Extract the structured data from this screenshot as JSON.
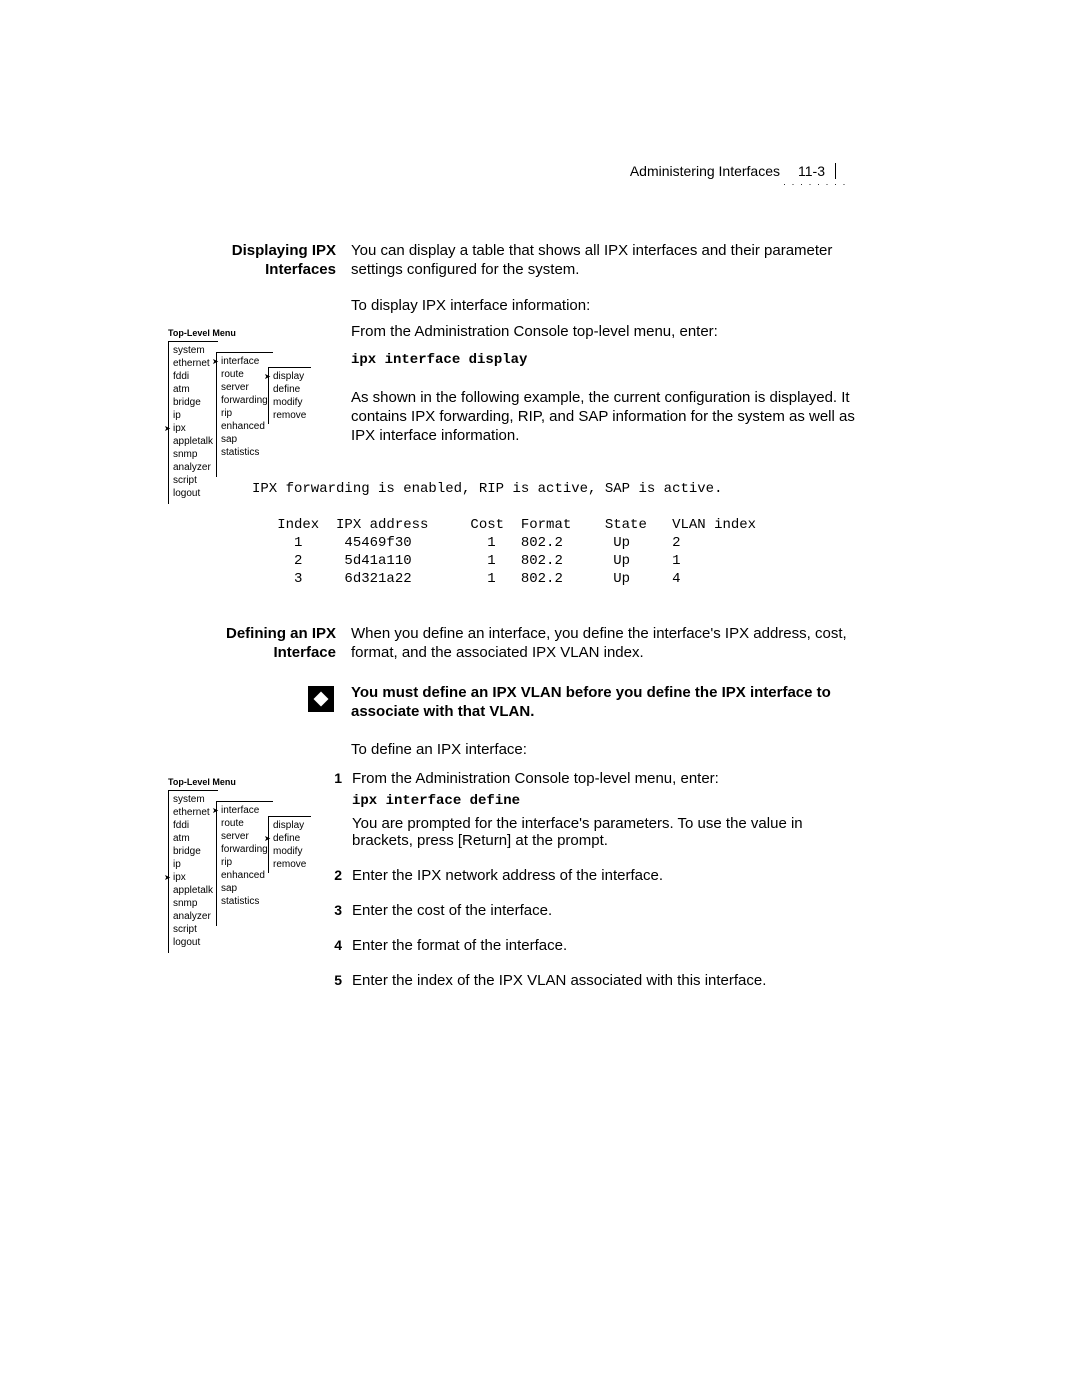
{
  "header": {
    "title": "Administering Interfaces",
    "pagenum": "11-3"
  },
  "s1": {
    "heading_l1": "Displaying IPX",
    "heading_l2": "Interfaces",
    "p1": "You can display a table that shows all IPX interfaces and their parameter settings configured for the system.",
    "p2": "To display IPX interface information:",
    "p3": "From the Administration Console top-level menu, enter:",
    "cmd": "ipx interface display",
    "p4": "As shown in the following example, the current configuration is displayed. It contains IPX forwarding, RIP, and SAP information for the system as well as IPX interface information.",
    "example": "IPX forwarding is enabled, RIP is active, SAP is active.\n\n   Index  IPX address     Cost  Format    State   VLAN index\n     1     45469f30         1   802.2      Up     2\n     2     5d41a110         1   802.2      Up     1\n     3     6d321a22         1   802.2      Up     4"
  },
  "s2": {
    "heading_l1": "Defining an IPX",
    "heading_l2": "Interface",
    "p1": "When you define an interface, you define the interface's IPX address, cost, format, and the associated IPX VLAN index.",
    "note": "You must define an IPX VLAN before you define the IPX interface to associate with that VLAN.",
    "p2": "To define an IPX interface:",
    "steps": {
      "1a": "From the Administration Console top-level menu, enter:",
      "cmd": "ipx interface define",
      "1b": "You are prompted for the interface's parameters. To use the value in brackets, press [Return] at the prompt.",
      "2": "Enter the IPX network address of the interface.",
      "3": "Enter the cost of the interface.",
      "4": "Enter the format of the interface.",
      "5": "Enter the index of the IPX VLAN associated with this interface."
    }
  },
  "menu": {
    "label": "Top-Level Menu",
    "col1": [
      "system",
      "ethernet",
      "fddi",
      "atm",
      "bridge",
      "ip",
      "ipx",
      "appletalk",
      "snmp",
      "analyzer",
      "script",
      "logout"
    ],
    "col2": [
      "interface",
      "route",
      "server",
      "forwarding",
      "rip",
      "enhanced",
      "sap",
      "statistics"
    ],
    "menu1_col3": [
      "display",
      "define",
      "modify",
      "remove"
    ],
    "menu2_col3": [
      "display",
      "define",
      "modify",
      "remove"
    ]
  },
  "chart_data": {
    "type": "table",
    "title": "IPX Interface Display Example",
    "status_line": "IPX forwarding is enabled, RIP is active, SAP is active.",
    "columns": [
      "Index",
      "IPX address",
      "Cost",
      "Format",
      "State",
      "VLAN index"
    ],
    "rows": [
      [
        1,
        "45469f30",
        1,
        "802.2",
        "Up",
        2
      ],
      [
        2,
        "5d41a110",
        1,
        "802.2",
        "Up",
        1
      ],
      [
        3,
        "6d321a22",
        1,
        "802.2",
        "Up",
        4
      ]
    ]
  }
}
